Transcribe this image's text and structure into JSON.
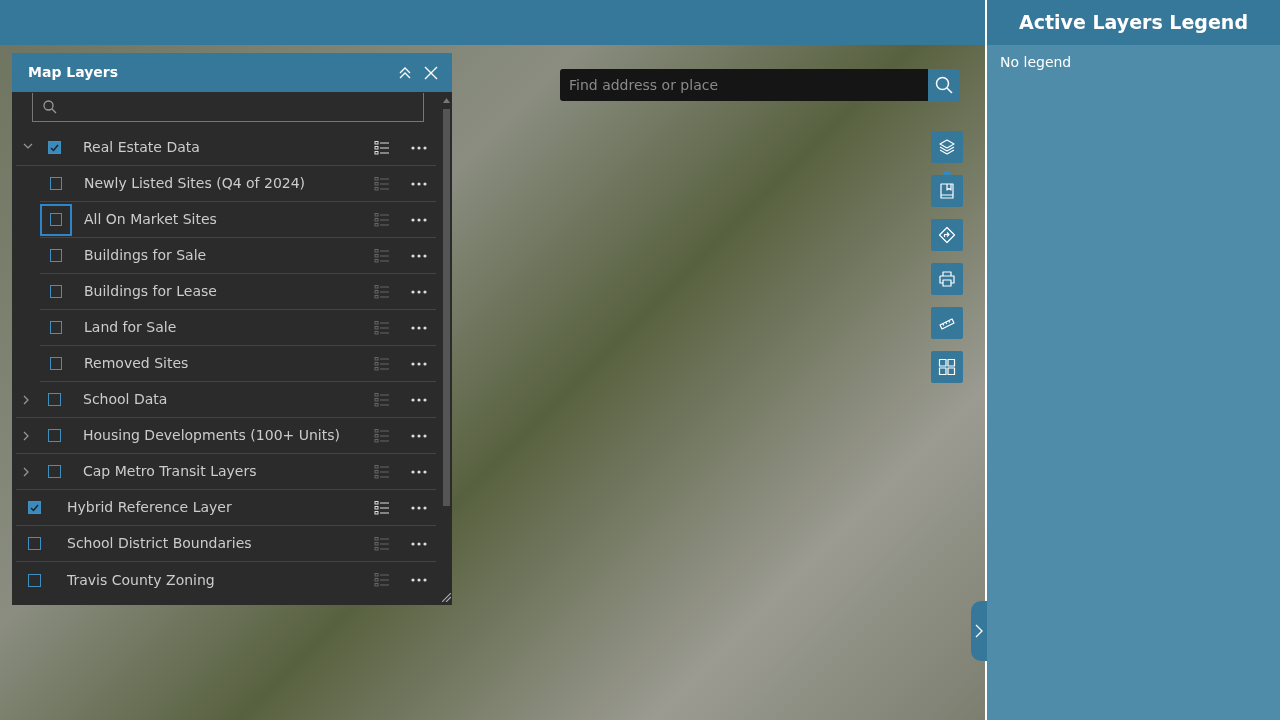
{
  "layers_panel": {
    "title": "Map Layers",
    "layers": [
      {
        "kind": "group",
        "label": "Real Estate Data",
        "checked": true,
        "expanded": true,
        "focused": false,
        "children": [
          {
            "kind": "layer",
            "label": "Newly Listed Sites (Q4 of 2024)",
            "checked": false,
            "focused": false
          },
          {
            "kind": "layer",
            "label": "All On Market Sites",
            "checked": false,
            "focused": true
          },
          {
            "kind": "layer",
            "label": "Buildings for Sale",
            "checked": false,
            "focused": false
          },
          {
            "kind": "layer",
            "label": "Buildings for Lease",
            "checked": false,
            "focused": false
          },
          {
            "kind": "layer",
            "label": "Land for Sale",
            "checked": false,
            "focused": false
          },
          {
            "kind": "layer",
            "label": "Removed Sites",
            "checked": false,
            "focused": false
          }
        ]
      },
      {
        "kind": "group",
        "label": "School Data",
        "checked": false,
        "expanded": false,
        "focused": false
      },
      {
        "kind": "group",
        "label": "Housing Developments (100+ Units)",
        "checked": false,
        "expanded": false,
        "focused": false
      },
      {
        "kind": "group",
        "label": "Cap Metro Transit Layers",
        "checked": false,
        "expanded": false,
        "focused": false
      },
      {
        "kind": "layer",
        "label": "Hybrid Reference Layer",
        "checked": true,
        "focused": false
      },
      {
        "kind": "layer",
        "label": "School District Boundaries",
        "checked": false,
        "focused": false
      },
      {
        "kind": "layer",
        "label": "Travis County Zoning",
        "checked": false,
        "focused": false
      }
    ]
  },
  "map_search": {
    "placeholder": "Find address or place"
  },
  "map_tools": [
    {
      "kind": "layers"
    },
    {
      "kind": "bookmark"
    },
    {
      "kind": "directions"
    },
    {
      "kind": "print"
    },
    {
      "kind": "measure"
    },
    {
      "kind": "grid"
    }
  ],
  "legend_panel": {
    "title": "Active Layers Legend",
    "message": "No legend"
  }
}
